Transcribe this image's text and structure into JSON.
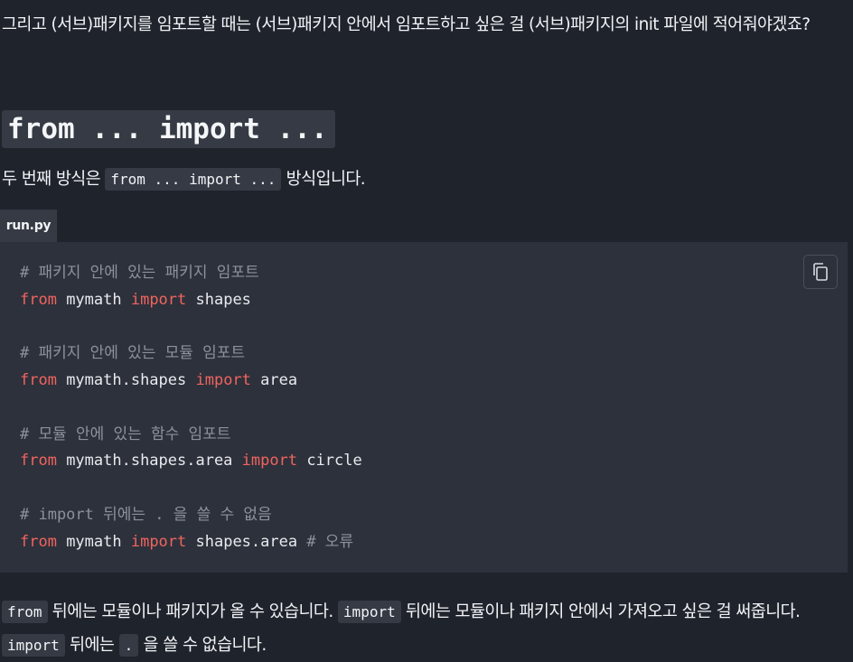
{
  "intro": {
    "text": "그리고 (서브)패키지를 임포트할 때는 (서브)패키지 안에서 임포트하고 싶은 걸 (서브)패키지의 init 파일에 적어줘야겠죠?"
  },
  "section": {
    "heading": "from ... import ...",
    "desc_before": "두 번째 방식은 ",
    "desc_code": "from ... import ...",
    "desc_after": " 방식입니다."
  },
  "code_block": {
    "filename": "run.py",
    "copy_icon": "copy-icon",
    "lines": [
      [
        {
          "t": "comment",
          "v": "# 패키지 안에 있는 패키지 임포트"
        }
      ],
      [
        {
          "t": "kw",
          "v": "from"
        },
        {
          "t": "plain",
          "v": " mymath "
        },
        {
          "t": "kw",
          "v": "import"
        },
        {
          "t": "plain",
          "v": " shapes"
        }
      ],
      [],
      [
        {
          "t": "comment",
          "v": "# 패키지 안에 있는 모듈 임포트"
        }
      ],
      [
        {
          "t": "kw",
          "v": "from"
        },
        {
          "t": "plain",
          "v": " mymath.shapes "
        },
        {
          "t": "kw",
          "v": "import"
        },
        {
          "t": "plain",
          "v": " area"
        }
      ],
      [],
      [
        {
          "t": "comment",
          "v": "# 모듈 안에 있는 함수 임포트"
        }
      ],
      [
        {
          "t": "kw",
          "v": "from"
        },
        {
          "t": "plain",
          "v": " mymath.shapes.area "
        },
        {
          "t": "kw",
          "v": "import"
        },
        {
          "t": "plain",
          "v": " circle"
        }
      ],
      [],
      [
        {
          "t": "comment",
          "v": "# import 뒤에는 . 을 쓸 수 없음"
        }
      ],
      [
        {
          "t": "kw",
          "v": "from"
        },
        {
          "t": "plain",
          "v": " mymath "
        },
        {
          "t": "kw",
          "v": "import"
        },
        {
          "t": "plain",
          "v": " shapes.area "
        },
        {
          "t": "comment",
          "v": "# 오류"
        }
      ]
    ]
  },
  "outro": {
    "code_from": "from",
    "text_1": " 뒤에는 모듈이나 패키지가 올 수 있습니다. ",
    "code_import_1": "import",
    "text_2": " 뒤에는 모듈이나 패키지 안에서 가져오고 싶은 걸 써줍니다. ",
    "code_import_2": "import",
    "text_3": " 뒤에는 ",
    "code_dot": ".",
    "text_4": " 을 쓸 수 없습니다."
  },
  "colors": {
    "background": "#1f232b",
    "code_background": "#2d313b",
    "inline_code_background": "#353a44",
    "keyword": "#f0645f",
    "comment": "#8c919c",
    "text": "#f1f3f6"
  }
}
